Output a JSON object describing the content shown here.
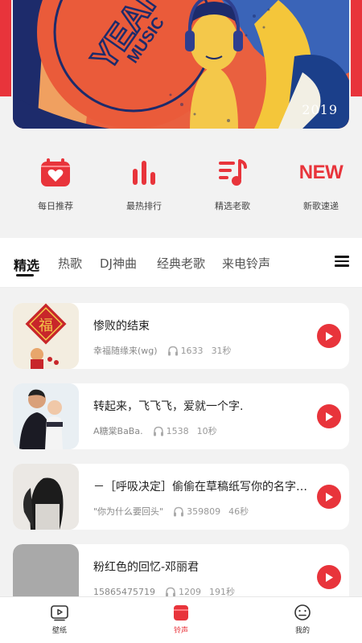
{
  "banner": {
    "year_text": "2019"
  },
  "quick_menu": [
    {
      "label": "每日推荐",
      "icon": "calendar-heart-icon"
    },
    {
      "label": "最热排行",
      "icon": "bar-chart-icon"
    },
    {
      "label": "精选老歌",
      "icon": "playlist-note-icon"
    },
    {
      "label": "新歌速递",
      "icon": "new-badge-icon",
      "icon_text": "NEW"
    }
  ],
  "tabs": [
    {
      "label": "精选",
      "active": true
    },
    {
      "label": "热歌"
    },
    {
      "label": "DJ神曲"
    },
    {
      "label": "经典老歌"
    },
    {
      "label": "来电铃声"
    }
  ],
  "songs": [
    {
      "title": "惨败的结束",
      "author": "幸福随缘来(wg)",
      "plays": "1633",
      "duration": "31秒"
    },
    {
      "title": "转起来，飞飞飞，爱就一个字.",
      "author": "A糖棠BaBa.",
      "plays": "1538",
      "duration": "10秒"
    },
    {
      "title": "－［呼吸决定］偷偷在草稿纸写你的名字…",
      "author": "\"你为什么要回头\"",
      "plays": "359809",
      "duration": "46秒"
    },
    {
      "title": "粉红色的回忆-邓丽君",
      "author": "15865475719",
      "plays": "1209",
      "duration": "191秒"
    }
  ],
  "bottom_nav": [
    {
      "label": "壁纸",
      "icon": "video-icon"
    },
    {
      "label": "铃声",
      "icon": "ringtone-icon",
      "active": true
    },
    {
      "label": "我的",
      "icon": "profile-face-icon"
    }
  ],
  "colors": {
    "accent": "#e8343b",
    "background": "#f2f2f2",
    "card": "#ffffff"
  }
}
